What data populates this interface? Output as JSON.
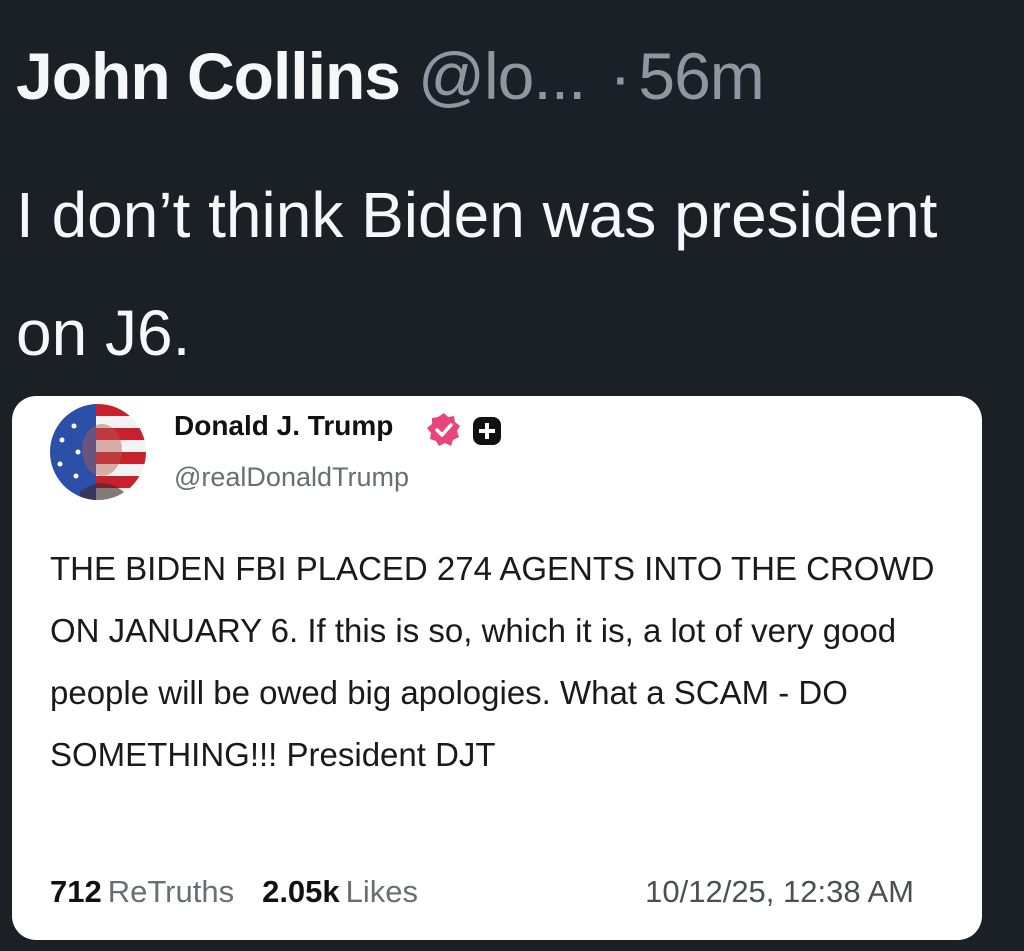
{
  "tweet": {
    "author_name": "John Collins",
    "author_handle": "@lo...",
    "separator": "·",
    "time": "56m",
    "text": "I don’t think Biden was president on J6."
  },
  "quoted_post": {
    "author_name": "Donald J. Trump",
    "author_handle": "@realDonaldTrump",
    "verified_icon": "verified-badge-icon",
    "text": "THE BIDEN FBI PLACED 274 AGENTS INTO THE CROWD ON JANUARY 6. If this is so, which it is, a lot of very good people will be owed big apologies. What a SCAM - DO SOMETHING!!! President DJT",
    "retruths_count": "712",
    "retruths_label": "ReTruths",
    "likes_count": "2.05k",
    "likes_label": "Likes",
    "timestamp": "10/12/25, 12:38 AM"
  },
  "colors": {
    "background": "#1b1f26",
    "primary_text": "#f5f7f8",
    "secondary_text": "#8e979f",
    "card_background": "#ffffff",
    "verified_badge": "#e8457b"
  }
}
